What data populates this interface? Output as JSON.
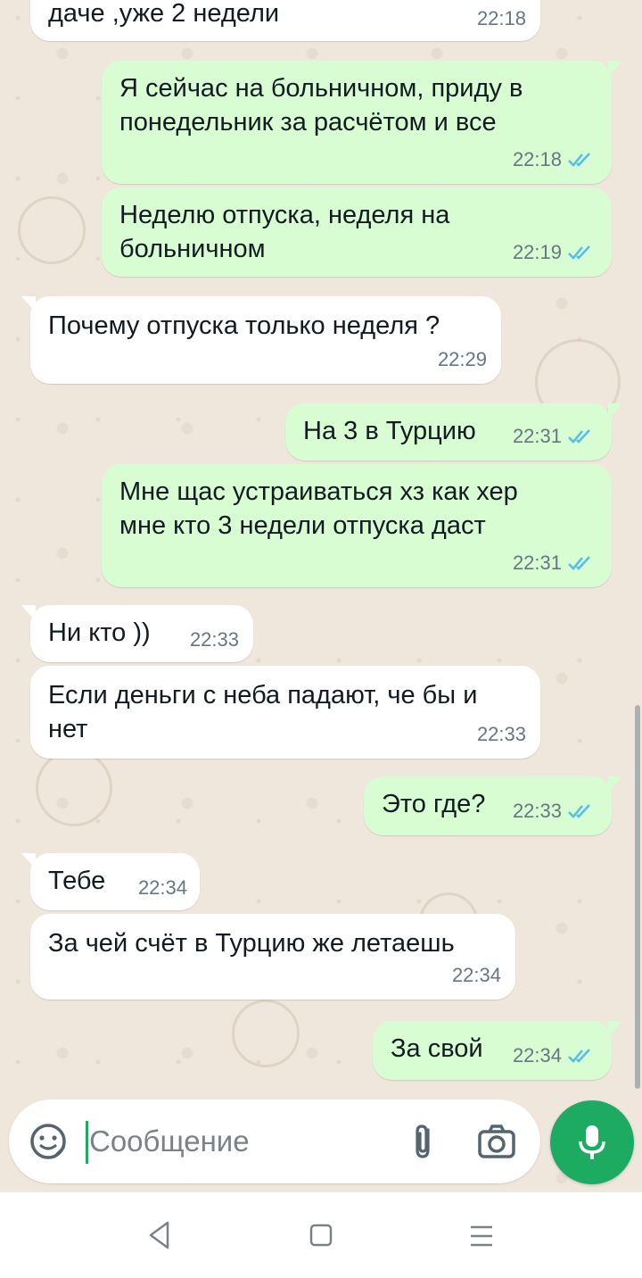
{
  "messages": [
    {
      "dir": "in",
      "text": "даче ,уже 2 недели",
      "time": "22:18",
      "read": false
    },
    {
      "dir": "out",
      "text": "Я сейчас на больничном, приду в\nпонедельник за расчётом и все",
      "time": "22:18",
      "read": true
    },
    {
      "dir": "out",
      "text": "Неделю отпуска, неделя на\nбольничном",
      "time": "22:19",
      "read": true
    },
    {
      "dir": "in",
      "text": "Почему отпуска только неделя ?",
      "time": "22:29",
      "read": false
    },
    {
      "dir": "out",
      "text": "На 3 в Турцию",
      "time": "22:31",
      "read": true
    },
    {
      "dir": "out",
      "text": "Мне щас устраиваться хз как хер\nмне кто 3 недели отпуска даст",
      "time": "22:31",
      "read": true
    },
    {
      "dir": "in",
      "text": "Ни кто ))",
      "time": "22:33",
      "read": false
    },
    {
      "dir": "in",
      "text": "Если деньги с неба падают, че бы и\nнет",
      "time": "22:33",
      "read": false
    },
    {
      "dir": "out",
      "text": "Это где?",
      "time": "22:33",
      "read": true
    },
    {
      "dir": "in",
      "text": "Тебе",
      "time": "22:34",
      "read": false
    },
    {
      "dir": "in",
      "text": "За чей счёт в Турцию же летаешь",
      "time": "22:34",
      "read": false
    },
    {
      "dir": "out",
      "text": "За свой",
      "time": "22:34",
      "read": true
    }
  ],
  "composer": {
    "placeholder": "Сообщение",
    "icons": [
      "sticker-icon",
      "attach-icon",
      "camera-icon",
      "mic-icon"
    ]
  },
  "navbar": {
    "icons": [
      "back-icon",
      "home-icon",
      "menu-icon"
    ]
  },
  "colors": {
    "incoming": "#ffffff",
    "outgoing": "#d9fdd3",
    "accent": "#1daa61",
    "read_ticks": "#53bdeb",
    "chat_bg": "#efe7dc"
  }
}
